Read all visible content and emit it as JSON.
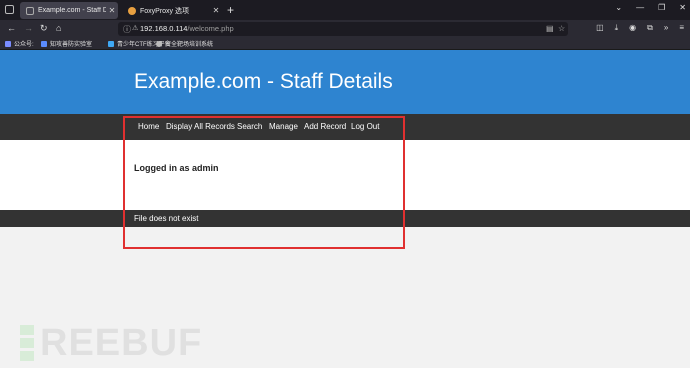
{
  "browser": {
    "tabs": [
      {
        "title": "Example.com - Staff Details - We",
        "active": true
      },
      {
        "title": "FoxyProxy 选项",
        "active": false
      }
    ],
    "url_host": "192.168.0.114",
    "url_path": "/welcome.php",
    "bookmarks": [
      "公众号:",
      "知攻善防实验室",
      "青少年CTF练习平台",
      "安全靶场培训系统"
    ]
  },
  "page": {
    "title": "Example.com - Staff Details",
    "menu": [
      "Home",
      "Display All Records",
      "Search",
      "Manage",
      "Add Record",
      "Log Out"
    ],
    "logged_in_text": "Logged in as admin",
    "footer_text": "File does not exist"
  },
  "watermark": "REEBUF",
  "colors": {
    "header": "#2e84d0",
    "menu_bar": "#333333",
    "highlight_border": "#e03030"
  }
}
